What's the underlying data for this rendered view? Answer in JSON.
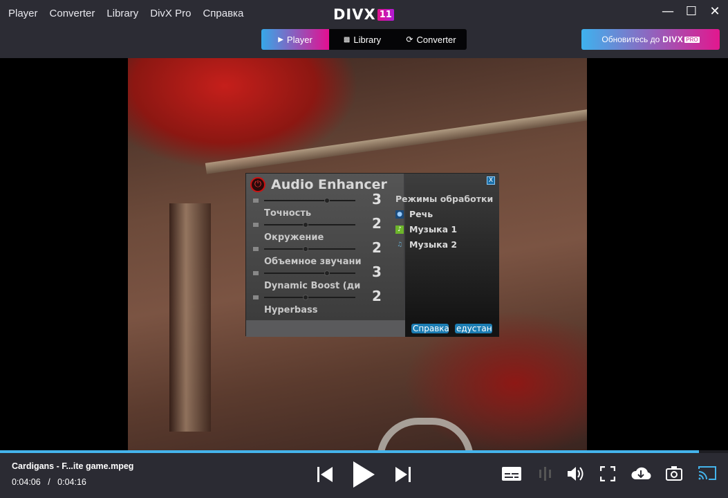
{
  "menu": [
    "Player",
    "Converter",
    "Library",
    "DivX Pro",
    "Справка"
  ],
  "logo": {
    "text": "DIVX",
    "badge": "11"
  },
  "tabs": [
    {
      "label": "Player",
      "icon": "play-icon"
    },
    {
      "label": "Library",
      "icon": "library-icon"
    },
    {
      "label": "Converter",
      "icon": "convert-icon"
    }
  ],
  "upgrade": {
    "label": "Обновитесь до",
    "brand": "DIVX",
    "badge": "PRO"
  },
  "window_controls": [
    "minimize-icon",
    "maximize-icon",
    "close-icon"
  ],
  "audio_enhancer": {
    "title": "Audio Enhancer",
    "sliders": [
      {
        "value": "3",
        "label": "Точность",
        "level": 0.7
      },
      {
        "value": "2",
        "label": "Окружение",
        "level": 0.45
      },
      {
        "value": "2",
        "label": "Объемное звучание",
        "level": 0.45
      },
      {
        "value": "3",
        "label": "Dynamic Boost (дина",
        "level": 0.7
      },
      {
        "value": "2",
        "label": "Hyperbass",
        "level": 0.45
      }
    ],
    "modes_header": "Режимы обработки",
    "modes": [
      {
        "label": "Речь",
        "icon": "speech-icon"
      },
      {
        "label": "Музыка 1",
        "icon": "music-note-icon"
      },
      {
        "label": "Музыка 2",
        "icon": "music-notes-icon"
      }
    ],
    "help_button": "Справка",
    "default_button": "едустано",
    "close_label": "X"
  },
  "playback": {
    "file_name": "Cardigans - F...ite game.mpeg",
    "current_time": "0:04:06",
    "separator": "/",
    "total_time": "0:04:16",
    "progress": 0.96
  },
  "colors": {
    "accent_blue": "#44b4ec",
    "accent_pink": "#e30f91",
    "background": "#2b2b33"
  }
}
